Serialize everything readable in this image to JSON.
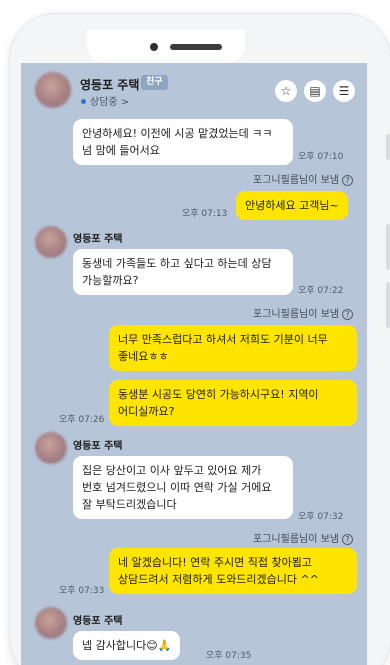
{
  "header": {
    "name": "영등포 주택",
    "badge": "친구",
    "status": "상담중 >",
    "icons": [
      "star-icon",
      "document-icon",
      "menu-icon"
    ]
  },
  "messages": [
    {
      "side": "left",
      "text": "안녕하세요! 이전에 시공 맡겼었는데 ㅋㅋ 넘 맘에 들어서요",
      "time": "오후 07:10"
    },
    {
      "side": "right",
      "sent_by": "포그니필름님이 보냄",
      "text": "안녕하세요 고객님~",
      "time": "오후 07:13"
    },
    {
      "side": "left",
      "sender": "영등포 주택",
      "text": "동생네 가족들도 하고 싶다고 하는데 상담 가능할까요?",
      "time": "오후 07:22"
    },
    {
      "side": "right",
      "sent_by": "포그니필름님이 보냄",
      "text": "너무 만족스럽다고 하셔서 저희도 기분이 너무 좋네요ㅎㅎ"
    },
    {
      "side": "right",
      "text": "동생분 시공도 당연히 가능하시구요! 지역이 어디실까요?",
      "time": "오후 07:26"
    },
    {
      "side": "left",
      "sender": "영등포 주택",
      "text": "집은 당산이고 이사 앞두고 있어요 제가 번호 넘겨드렸으니 이따 연락 가실 거에요 잘 부탁드리겠습니다",
      "time": "오후 07:32"
    },
    {
      "side": "right",
      "sent_by": "포그니필름님이 보냄",
      "text": "네 알겠습니다! 연락 주시면 직접 찾아뵙고 상담드려서 저렴하게 도와드리겠습니다 ^^",
      "time": "오후 07:33"
    },
    {
      "side": "left",
      "sender": "영등포 주택",
      "text": "넵 감사합니다😊🙏",
      "time": "오후 07:35"
    }
  ]
}
